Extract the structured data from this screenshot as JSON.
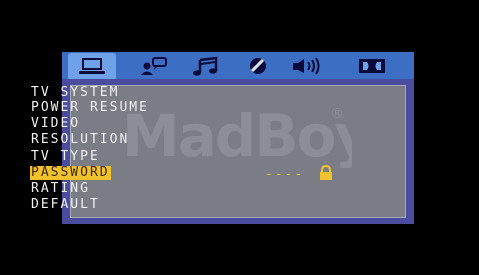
{
  "menu": {
    "tabs": [
      {
        "icon": "tv-display-icon",
        "active": true
      },
      {
        "icon": "person-speech-icon",
        "active": false
      },
      {
        "icon": "music-note-icon",
        "active": false
      },
      {
        "icon": "disc-icon",
        "active": false
      },
      {
        "icon": "speaker-icon",
        "active": false
      },
      {
        "icon": "dolby-icon",
        "active": false
      }
    ],
    "items": [
      {
        "label": "TV SYSTEM"
      },
      {
        "label": "POWER RESUME"
      },
      {
        "label": "VIDEO"
      },
      {
        "label": "RESOLUTION"
      },
      {
        "label": "TV TYPE"
      },
      {
        "label": "PASSWORD",
        "selected": true
      },
      {
        "label": "RATING"
      },
      {
        "label": "DEFAULT"
      }
    ],
    "password_value": "----"
  },
  "watermark": {
    "text": "MadBoy",
    "mark": "®"
  },
  "colors": {
    "background": "#000000",
    "panel": "#4a4c9e",
    "tabbar": "#3c6fc4",
    "active_tab": "#6fa1e8",
    "content": "#7a7c86",
    "highlight": "#f2c12e",
    "text": "#f2f2f2"
  }
}
